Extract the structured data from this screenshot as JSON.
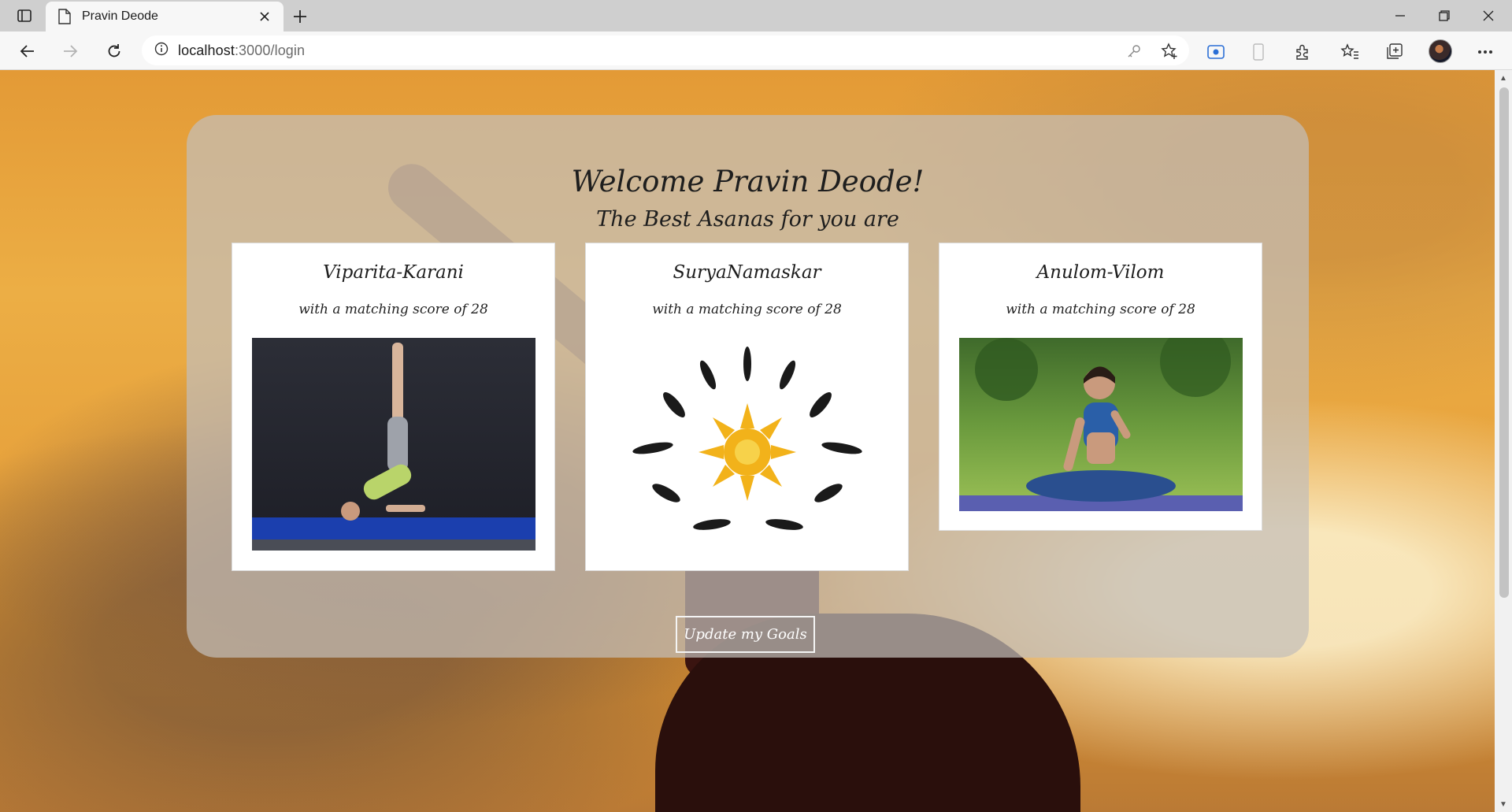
{
  "browser": {
    "tab_title": "Pravin Deode",
    "url_host": "localhost",
    "url_rest": ":3000/login"
  },
  "page": {
    "welcome": "Welcome Pravin Deode!",
    "subtitle": "The Best Asanas for you are",
    "cards": [
      {
        "title": "Viparita-Karani",
        "score_text": "with a matching score of 28"
      },
      {
        "title": "SuryaNamaskar",
        "score_text": "with a matching score of 28"
      },
      {
        "title": "Anulom-Vilom",
        "score_text": "with a matching score of 28"
      }
    ],
    "update_button": "Update my Goals"
  }
}
